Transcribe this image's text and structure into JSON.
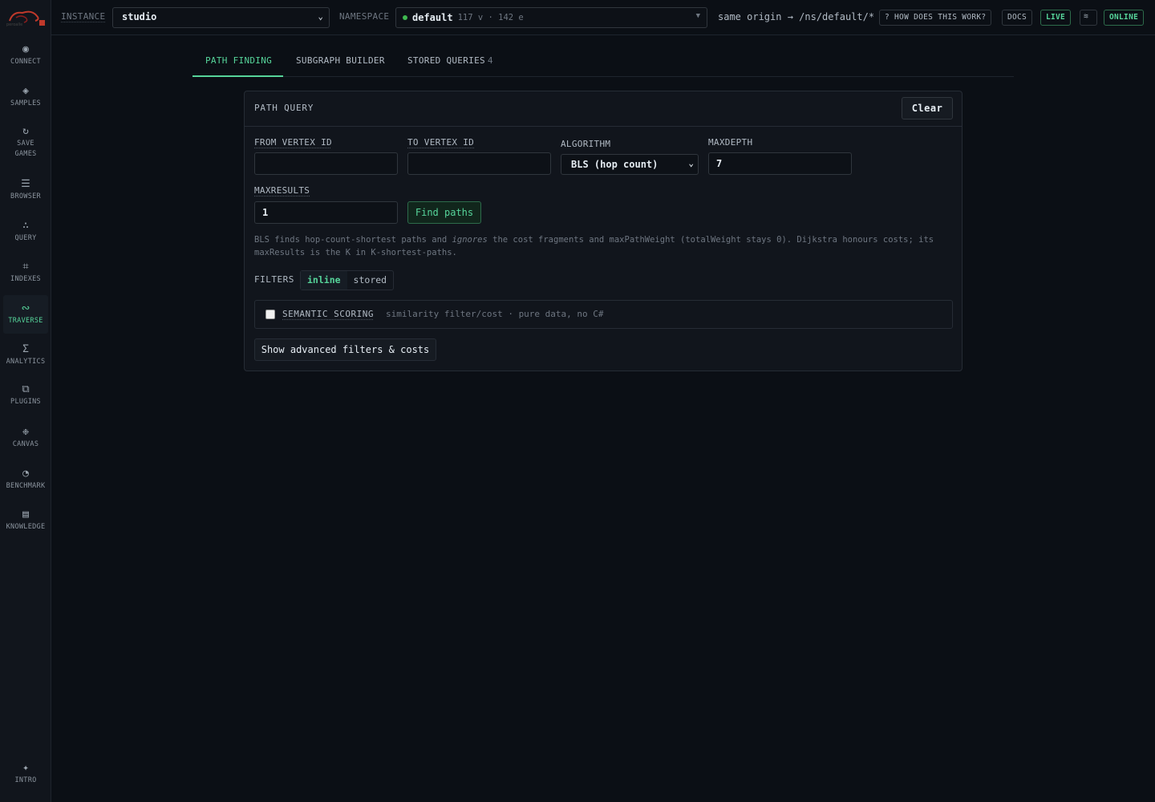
{
  "sidebar": {
    "logo_icon": "tentacle-logo-icon",
    "items": [
      {
        "label": "CONNECT",
        "icon": "◉"
      },
      {
        "label": "SAMPLES",
        "icon": "◈"
      },
      {
        "label": "SAVE\nGAMES",
        "icon": "↻"
      },
      {
        "label": "BROWSER",
        "icon": "☰"
      },
      {
        "label": "QUERY",
        "icon": "∴"
      },
      {
        "label": "INDEXES",
        "icon": "⌗"
      },
      {
        "label": "TRAVERSE",
        "icon": "∾"
      },
      {
        "label": "ANALYTICS",
        "icon": "Σ"
      },
      {
        "label": "PLUGINS",
        "icon": "⧉"
      },
      {
        "label": "CANVAS",
        "icon": "❉"
      },
      {
        "label": "BENCHMARK",
        "icon": "◔"
      },
      {
        "label": "KNOWLEDGE",
        "icon": "▤"
      }
    ],
    "intro": {
      "label": "INTRO",
      "icon": "✦"
    }
  },
  "topbar": {
    "instance_label": "INSTANCE",
    "instance_value": "studio",
    "namespace_label": "NAMESPACE",
    "namespace_name": "default",
    "namespace_counts": "117 v · 142 e",
    "origin": "same origin → /ns/default/*",
    "help": "? HOW DOES THIS WORK?",
    "docs": "DOCS",
    "live": "LIVE",
    "theme_icon": "≋",
    "status": "ONLINE"
  },
  "tabs": [
    {
      "label": "PATH FINDING"
    },
    {
      "label": "SUBGRAPH BUILDER"
    },
    {
      "label": "STORED QUERIES",
      "count": "4"
    }
  ],
  "panel": {
    "title": "PATH QUERY",
    "clear": "Clear",
    "from_label": "FROM VERTEX ID",
    "from_value": "",
    "to_label": "TO VERTEX ID",
    "to_value": "",
    "algorithm_label": "ALGORITHM",
    "algorithm_value": "BLS (hop count)",
    "maxdepth_label": "MAXDEPTH",
    "maxdepth_value": "7",
    "maxresults_label": "MAXRESULTS",
    "maxresults_value": "1",
    "find": "Find paths",
    "help_pre": "BLS finds hop-count-shortest paths and ",
    "help_em": "ignores",
    "help_post": " the cost fragments and maxPathWeight (totalWeight stays 0). Dijkstra honours costs; its maxResults is the K in K-shortest-paths.",
    "filters_label": "FILTERS",
    "filter_inline": "inline",
    "filter_stored": "stored",
    "semantic_title": "SEMANTIC SCORING",
    "semantic_sub": "similarity filter/cost · pure data, no C#",
    "advanced": "Show advanced filters & costs"
  }
}
